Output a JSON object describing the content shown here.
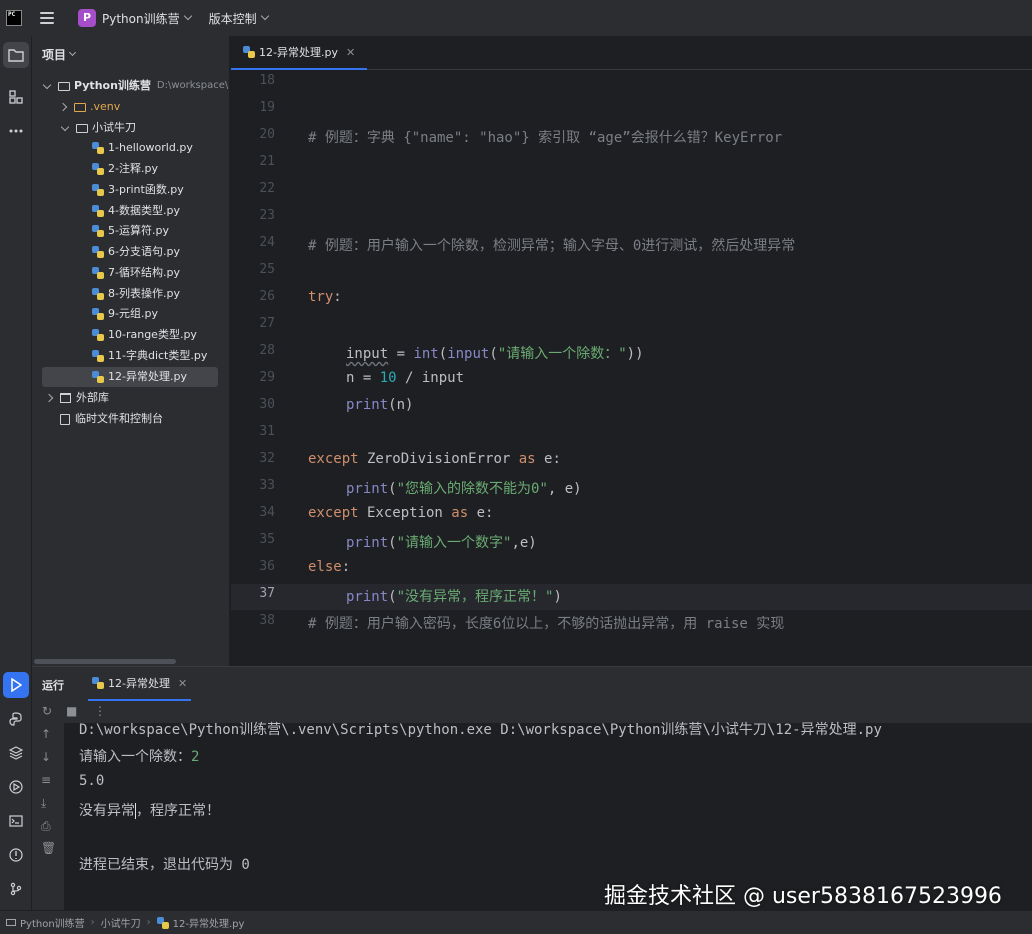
{
  "titlebar": {
    "logo_text": "PC",
    "project_badge": "P",
    "project_name": "Python训练营",
    "vcs_label": "版本控制"
  },
  "toolstrip": {
    "icons": [
      "folder-icon",
      "structure-icon",
      "more-icon"
    ],
    "bottom_icons": [
      "run-icon",
      "python-console-icon",
      "layers-icon",
      "services-icon",
      "terminal-icon",
      "problems-icon",
      "git-icon"
    ]
  },
  "project_panel": {
    "title": "项目",
    "root": {
      "name": "Python训练营",
      "path": "D:\\workspace\\P"
    },
    "venv": ".venv",
    "folder": "小试牛刀",
    "files": [
      "1-helloworld.py",
      "2-注释.py",
      "3-print函数.py",
      "4-数据类型.py",
      "5-运算符.py",
      "6-分支语句.py",
      "7-循环结构.py",
      "8-列表操作.py",
      "9-元组.py",
      "10-range类型.py",
      "11-字典dict类型.py",
      "12-异常处理.py"
    ],
    "selected_file": "12-异常处理.py",
    "external_libs": "外部库",
    "scratches": "临时文件和控制台"
  },
  "editor": {
    "tab": "12-异常处理.py",
    "current_line": 37,
    "line_numbers": [
      18,
      19,
      20,
      21,
      22,
      23,
      24,
      25,
      26,
      27,
      28,
      29,
      30,
      31,
      32,
      33,
      34,
      35,
      36,
      37,
      38
    ],
    "lines": {
      "l20": "# 例题：字典 {\"name\": \"hao\"} 索引取 “age”会报什么错？KeyError",
      "l24": "# 例题：用户输入一个除数，检测异常；输入字母、0进行测试，然后处理异常",
      "l26_kw": "try",
      "l26_colon": ":",
      "l28_var": "input",
      "l28_eq": " = ",
      "l28_int": "int",
      "l28_open": "(",
      "l28_input": "input",
      "l28_str": "\"请输入一个除数：\"",
      "l28_close": "))",
      "l29_a": "n = ",
      "l29_num": "10",
      "l29_b": " / input",
      "l30_fn": "print",
      "l30_rest": "(n)",
      "l32_kw": "except",
      "l32_cls": " ZeroDivisionError ",
      "l32_as": "as",
      "l32_rest": " e:",
      "l33_fn": "print",
      "l33_open": "(",
      "l33_str": "\"您输入的除数不能为0\"",
      "l33_rest": ", e)",
      "l34_kw": "except",
      "l34_cls": " Exception ",
      "l34_as": "as",
      "l34_rest": " e:",
      "l35_fn": "print",
      "l35_open": "(",
      "l35_str": "\"请输入一个数字\"",
      "l35_rest": ",e)",
      "l36_kw": "else",
      "l36_colon": ":",
      "l37_fn": "print",
      "l37_open": "(",
      "l37_str": "\"没有异常，程序正常！\"",
      "l37_close": ")",
      "l38": "# 例题：用户输入密码，长度6位以上，不够的话抛出异常，用 raise 实现"
    }
  },
  "run_panel": {
    "title": "运行",
    "tab": "12-异常处理",
    "console": {
      "command": "D:\\workspace\\Python训练营\\.venv\\Scripts\\python.exe D:\\workspace\\Python训练营\\小试牛刀\\12-异常处理.py",
      "prompt": "请输入一个除数：",
      "prompt_value": "2",
      "result": "5.0",
      "msg_a": "没有异常",
      "msg_b": "，程序正常！",
      "exit": "进程已结束，退出代码为 0"
    }
  },
  "statusbar": {
    "crumbs": [
      "Python训练营",
      "小试牛刀",
      "12-异常处理.py"
    ]
  },
  "watermark": "掘金技术社区 @ user5838167523996"
}
